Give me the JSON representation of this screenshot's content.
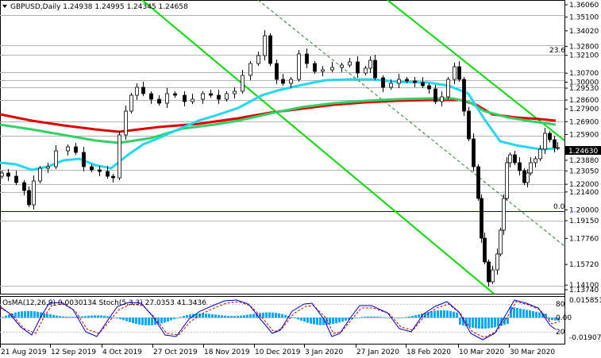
{
  "chart_title": {
    "menu_arrow_icon": "triangle-down",
    "symbol_info": "GBPUSD,Daily  1.24938 1.24995 1.24345 1.24658"
  },
  "price_axis": {
    "labels": [
      "1.36060",
      "1.35100",
      "1.34020",
      "1.32800",
      "1.32100",
      "1.30700",
      "1.30000",
      "1.29530",
      "1.28600",
      "1.27900",
      "1.26900",
      "1.25900",
      "1.24630",
      "1.23880",
      "1.23050",
      "1.22000",
      "1.21400",
      "1.20000",
      "1.19150",
      "1.17760",
      "1.15720",
      "1.14100",
      "1.13740"
    ],
    "current_price_tag": "1.24630"
  },
  "fib_labels": {
    "top": "23.6",
    "bottom": "0.0"
  },
  "osma": {
    "label": "OsMA(12,26,9) 0.0030134  Stoch(5,3,3) 27.0353 41.3436",
    "axis_labels": [
      "0.015851",
      "80",
      "0.00",
      "20",
      "-0.019076"
    ]
  },
  "time_axis": {
    "labels": [
      "21 Aug 2019",
      "12 Sep 2019",
      "4 Oct 2019",
      "27 Oct 2019",
      "18 Nov 2019",
      "10 Dec 2019",
      "3 Jan 2020",
      "27 Jan 2020",
      "18 Feb 2020",
      "10 Mar 2020",
      "30 Mar 2020"
    ]
  },
  "colors": {
    "candle": "#000000",
    "ma_red": "#e00000",
    "ma_green": "#33d066",
    "ma_cyan": "#22d8f0",
    "channel_green": "#00dd00",
    "level_blue": "#00009c",
    "stoch_blue": "#0000c8",
    "stoch_red": "#c80000",
    "osma_bars": "#0aa8ff",
    "price_tag_bg": "#000000"
  },
  "chart_data": {
    "type": "candlestick",
    "symbol": "GBPUSD",
    "timeframe": "Daily",
    "last_bar": {
      "open": 1.24938,
      "high": 1.24995,
      "low": 1.24345,
      "close": 1.24658
    },
    "indicators": {
      "osma_value": 0.0030134,
      "stoch_main": 27.0353,
      "stoch_signal": 41.3436
    },
    "fib_levels": [
      {
        "label": "23.6",
        "price": 1.321
      },
      {
        "label": "0.0",
        "price": 1.2
      }
    ],
    "close_path": [
      [
        "21 Aug 2019",
        1.217
      ],
      [
        "12 Sep 2019",
        1.246
      ],
      [
        "4 Oct 2019",
        1.232
      ],
      [
        "27 Oct 2019",
        1.286
      ],
      [
        "18 Nov 2019",
        1.292
      ],
      [
        "10 Dec 2019",
        1.318
      ],
      [
        "3 Jan 2020",
        1.309
      ],
      [
        "27 Jan 2020",
        1.307
      ],
      [
        "18 Feb 2020",
        1.299
      ],
      [
        "10 Mar 2020",
        1.289
      ],
      [
        "30 Mar 2020",
        1.241
      ]
    ]
  }
}
